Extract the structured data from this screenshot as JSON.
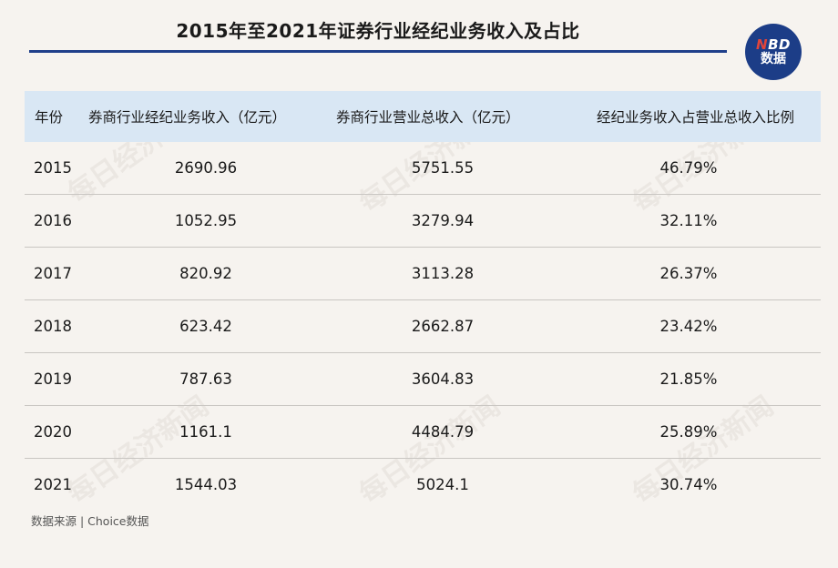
{
  "header": {
    "title": "2015年至2021年证券行业经纪业务收入及占比",
    "logo_line1_accent": "N",
    "logo_line1_rest": "BD",
    "logo_line2": "数据"
  },
  "table": {
    "columns": [
      "年份",
      "券商行业经纪业务收入（亿元）",
      "券商行业营业总收入（亿元）",
      "经纪业务收入占营业总收入比例"
    ],
    "rows": [
      [
        "2015",
        "2690.96",
        "5751.55",
        "46.79%"
      ],
      [
        "2016",
        "1052.95",
        "3279.94",
        "32.11%"
      ],
      [
        "2017",
        "820.92",
        "3113.28",
        "26.37%"
      ],
      [
        "2018",
        "623.42",
        "2662.87",
        "23.42%"
      ],
      [
        "2019",
        "787.63",
        "3604.83",
        "21.85%"
      ],
      [
        "2020",
        "1161.1",
        "4484.79",
        "25.89%"
      ],
      [
        "2021",
        "1544.03",
        "5024.1",
        "30.74%"
      ]
    ]
  },
  "footer": {
    "source": "数据来源 | Choice数据"
  },
  "watermark_text": "每日经济新闻",
  "colors": {
    "brand": "#1c3d87",
    "header_bg": "#d9e7f4",
    "background": "#f6f3ef"
  }
}
